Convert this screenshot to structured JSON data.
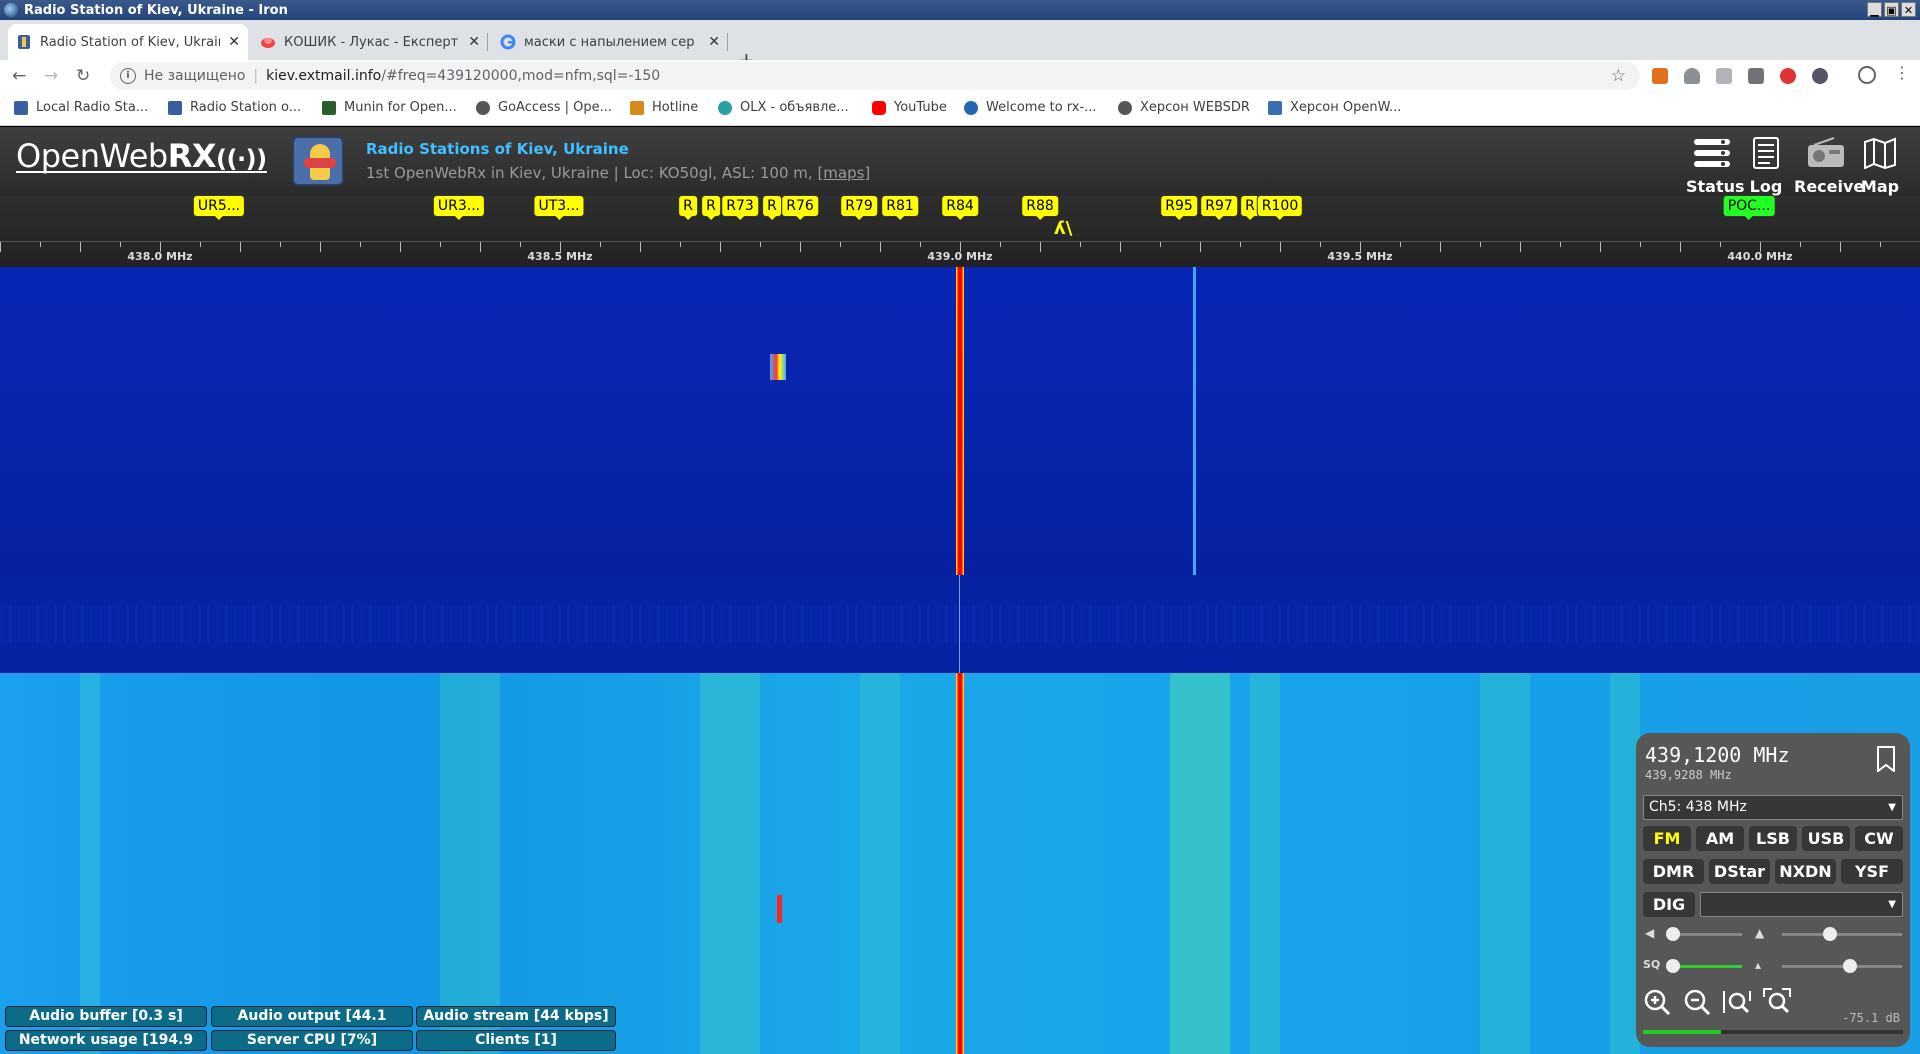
{
  "window": {
    "title": "Radio Station of Kiev, Ukraine - Iron"
  },
  "tabs": [
    {
      "title": "Radio Station of Kiev, Ukraine",
      "active": true
    },
    {
      "title": "КОШИК - Лукас - Експерт"
    },
    {
      "title": "маски с напылением сер"
    }
  ],
  "address": {
    "not_secure": "Не защищено",
    "host": "kiev.extmail.info",
    "path": "/#freq=439120000,mod=nfm,sql=-150"
  },
  "bookmarks": [
    "Local Radio Sta...",
    "Radio Station o...",
    "Munin for Open...",
    "GoAccess | Ope...",
    "Hotline",
    "OLX - объявле...",
    "YouTube",
    "Welcome to rx-...",
    "Херсон WEBSDR",
    "Херсон OpenW..."
  ],
  "header": {
    "logo_thin": "OpenWeb",
    "logo_bold": "RX",
    "logo_waves": "((·))",
    "station_title": "Radio Stations of Kiev, Ukraine",
    "station_desc": "1st OpenWebRx in Kiev, Ukraine | Loc: KO50gl, ASL: 100 m, ",
    "maps_link": "[maps]",
    "buttons": [
      "Status",
      "Log",
      "Receive",
      "Map"
    ]
  },
  "scale": {
    "labels": [
      "UR5...",
      "UR3...",
      "UT3...",
      "R",
      "R",
      "R73",
      "R",
      "R76",
      "R79",
      "R81",
      "R84",
      "R88",
      "R95",
      "R97",
      "R",
      "R100",
      "РОС..."
    ],
    "freq_labels": [
      "438.0 MHz",
      "438.5 MHz",
      "439.0 MHz",
      "439.5 MHz",
      "440.0 MHz"
    ],
    "tuner_glyph": "ʎ\\"
  },
  "status": {
    "audio_buffer": "Audio buffer [0.3 s]",
    "audio_output": "Audio output [44.1",
    "audio_stream": "Audio stream [44 kbps]",
    "network": "Network usage [194.9",
    "cpu": "Server CPU [7%]",
    "clients": "Clients [1]"
  },
  "panel": {
    "freq": "439,1200 MHz",
    "freq_secondary": "439,9288 MHz",
    "channel": "Ch5: 438 MHz",
    "modes_row1": [
      "FM",
      "AM",
      "LSB",
      "USB",
      "CW"
    ],
    "modes_row2": [
      "DMR",
      "DStar",
      "NXDN",
      "YSF"
    ],
    "dig": "DIG",
    "dig_select": "",
    "sq_label": "SQ",
    "db": "-75.1 dB",
    "volume": 0.02,
    "nr": 0.4,
    "squelch": 0.02,
    "agc": 0.57
  },
  "colors": {
    "accent": "#40c0ff",
    "label": "#ffff00",
    "active_mode": "#ffff00"
  }
}
